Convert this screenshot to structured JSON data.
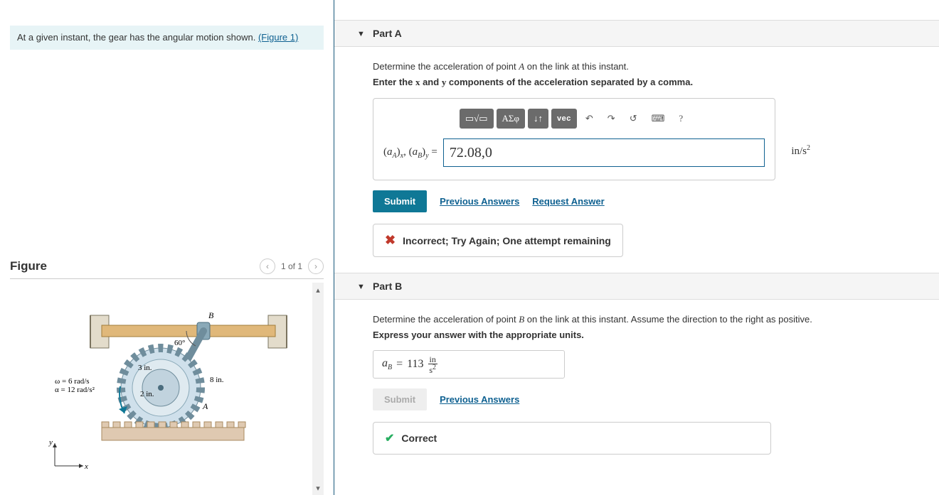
{
  "problem": {
    "statement_prefix": "At a given instant, the gear has the angular motion shown.",
    "figure_link_text": "(Figure 1)"
  },
  "figure": {
    "title": "Figure",
    "pager": "1 of 1",
    "labels": {
      "omega": "ω = 6 rad/s",
      "alpha": "α = 12 rad/s²",
      "r_inner": "2 in.",
      "r_mid": "3 in.",
      "r_outer": "8 in.",
      "angle": "60°",
      "pointA": "A",
      "pointB": "B",
      "axis_x": "x",
      "axis_y": "y"
    }
  },
  "partA": {
    "title": "Part A",
    "instr_line1_prefix": "Determine the acceleration of point ",
    "instr_line1_point": "A",
    "instr_line1_suffix": " on the link at this instant.",
    "instr_bold_prefix": "Enter the ",
    "instr_bold_mid": " and ",
    "instr_bold_suffix": " components of the acceleration separated by a comma.",
    "var_x": "x",
    "var_y": "y",
    "toolbar": {
      "templates": "▭√▭",
      "greek": "ΑΣφ",
      "arrows": "↓↑",
      "vec": "vec",
      "undo": "↶",
      "redo": "↷",
      "reset": "↺",
      "keyboard": "⌨",
      "help": "?"
    },
    "lhs": "(a_A)_x, (a_B)_y =",
    "value": "72.08,0",
    "unit": "in/s²",
    "submit": "Submit",
    "prev_answers": "Previous Answers",
    "request_answer": "Request Answer",
    "feedback": "Incorrect; Try Again; One attempt remaining"
  },
  "partB": {
    "title": "Part B",
    "instr_prefix": "Determine the acceleration of point ",
    "instr_point": "B",
    "instr_suffix": " on the link at this instant. Assume the direction to the right as positive.",
    "instr_bold": "Express your answer with the appropriate units.",
    "lhs_var": "a",
    "lhs_sub": "B",
    "eq": " = ",
    "value": "113",
    "unit_top": "in",
    "unit_bot": "s",
    "unit_sup": "2",
    "submit": "Submit",
    "prev_answers": "Previous Answers",
    "feedback": "Correct"
  }
}
